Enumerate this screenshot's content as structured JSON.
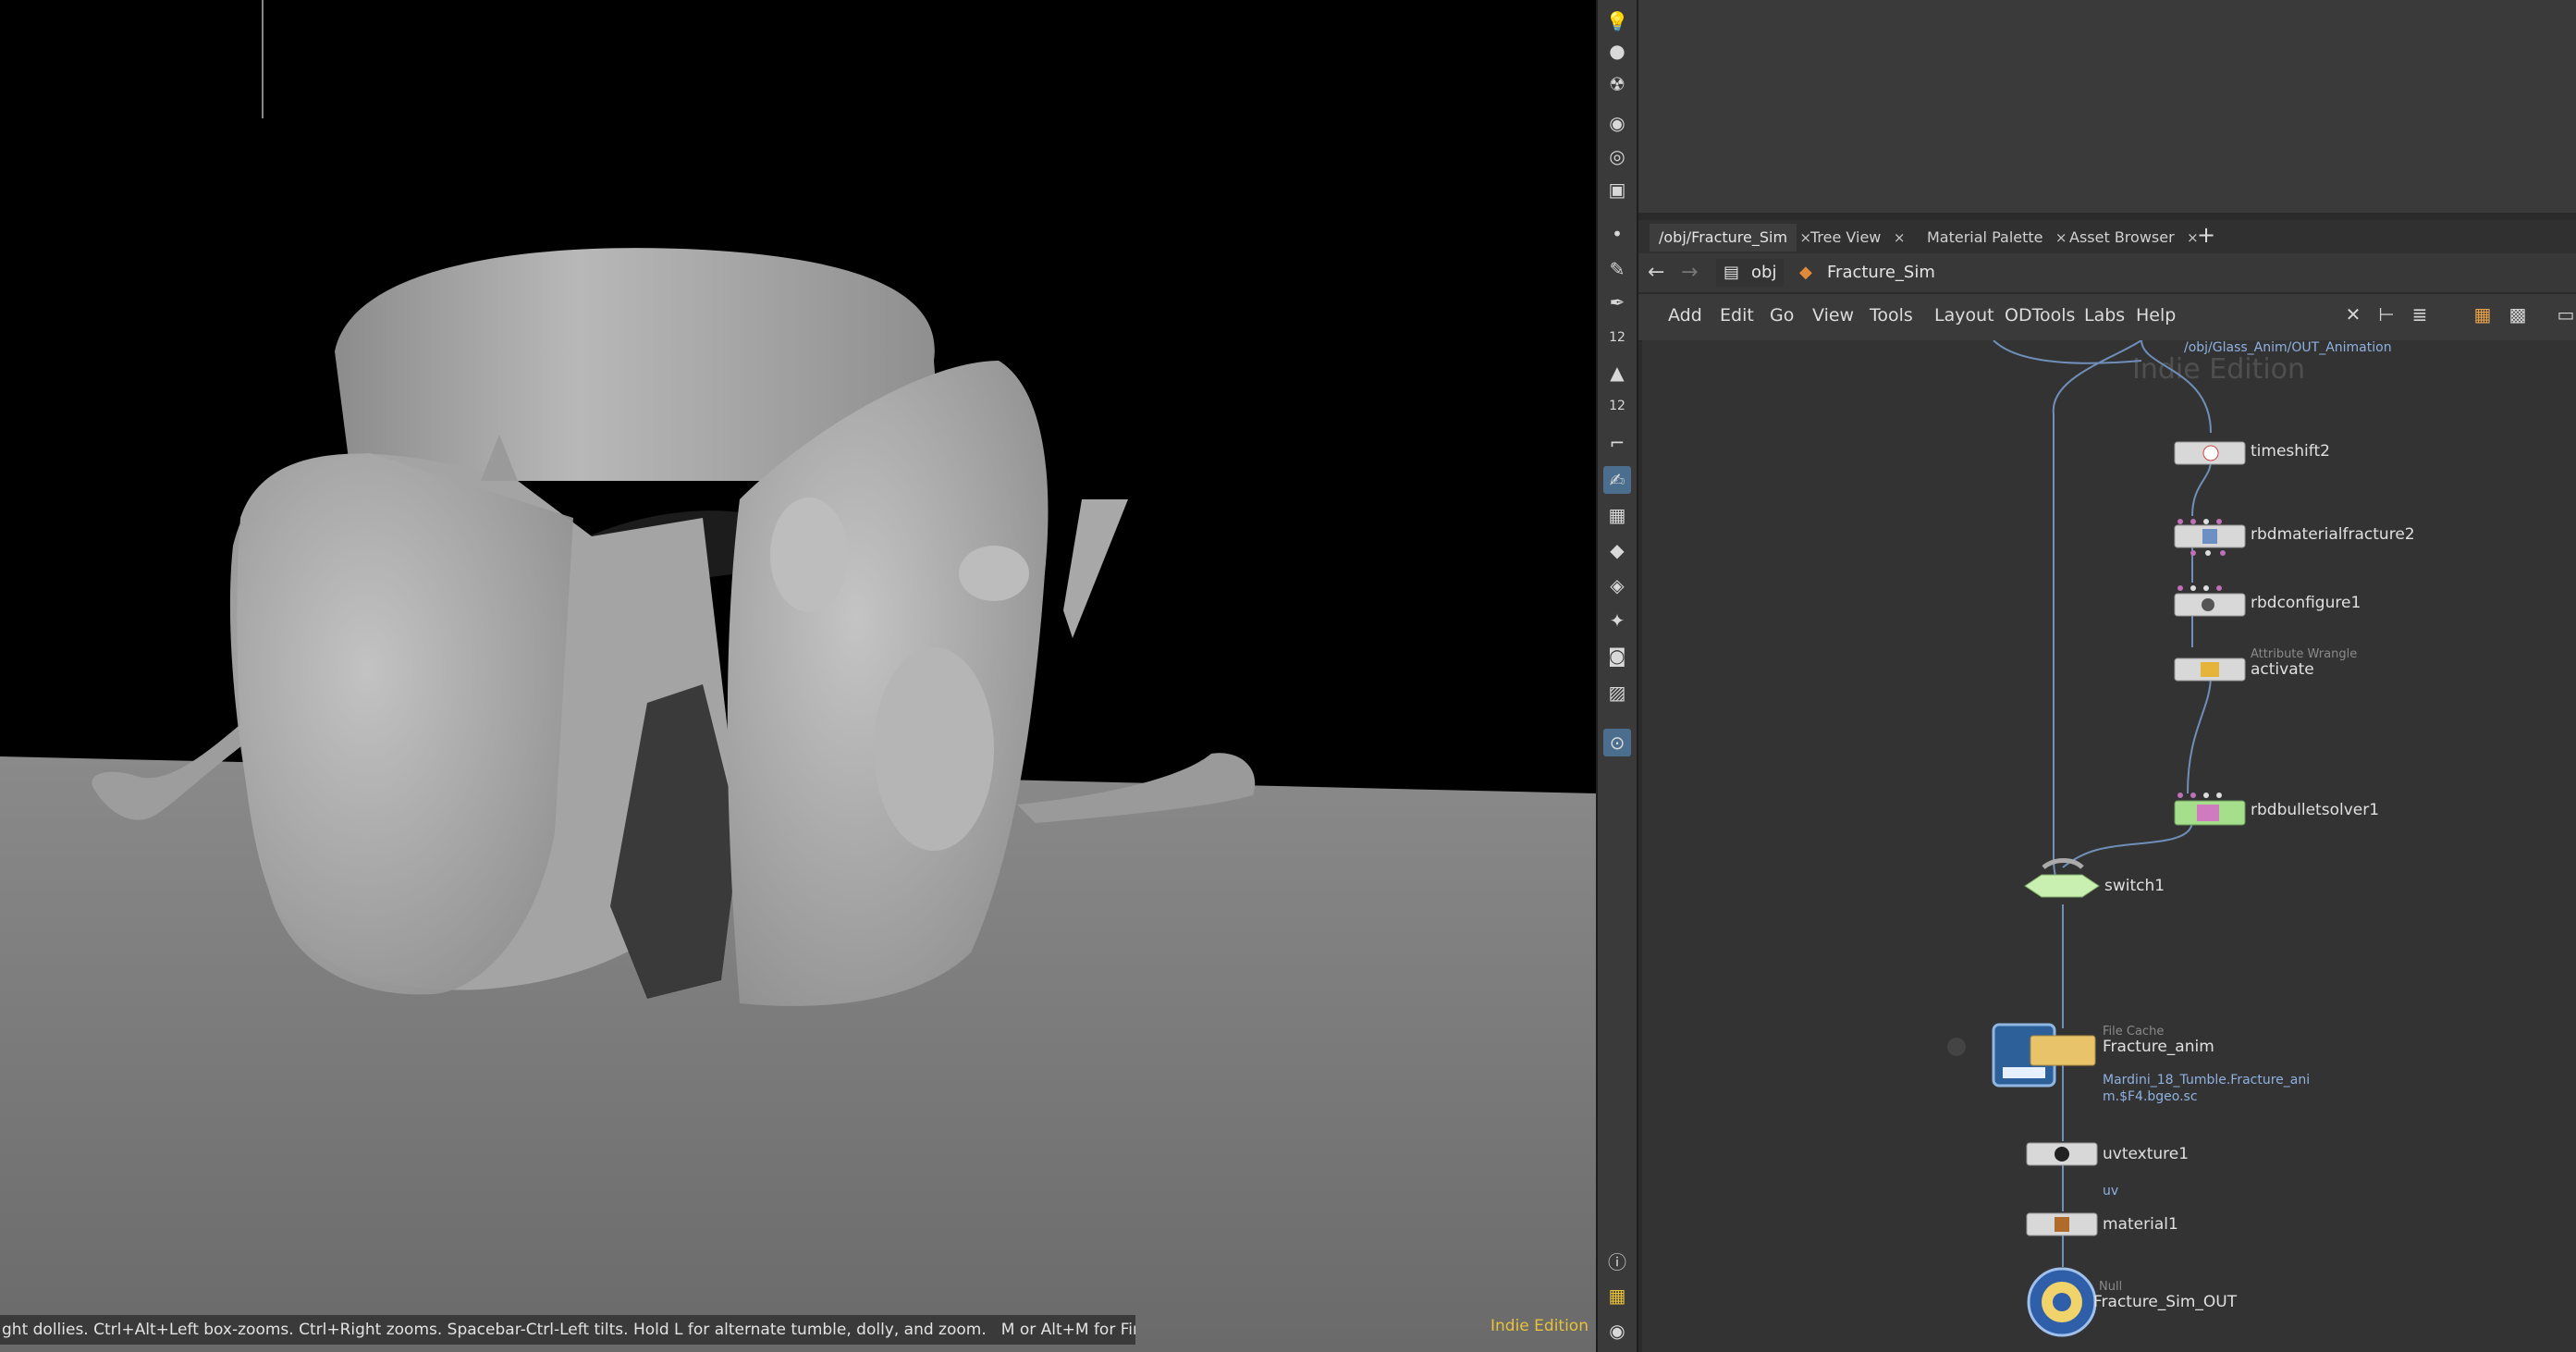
{
  "viewport": {
    "status_hint": "ght dollies. Ctrl+Alt+Left box-zooms. Ctrl+Right zooms. Spacebar-Ctrl-Left tilts. Hold L for alternate tumble, dolly, and zoom.",
    "status_hint2": "M or Alt+M for First Person Navigation.",
    "edition_label": "Indie Edition"
  },
  "shelf": {
    "icons": [
      "light-icon",
      "point-light-icon",
      "spot-light-icon",
      "camera-icon",
      "view-camera-icon",
      "flipbook-camera-icon",
      "dot-icon",
      "brush-icon",
      "pen-icon",
      "number-12-icon",
      "paint-icon",
      "number-12b-icon",
      "curve-icon",
      "select-pose-icon",
      "checker-icon",
      "transform-icon",
      "gem-icon",
      "measure-icon",
      "render-icon",
      "snapshot-icon",
      "pin-icon",
      "info-icon",
      "grid-icon",
      "eye-icon"
    ]
  },
  "tabs": [
    {
      "label": "/obj/Fracture_Sim",
      "close": "×"
    },
    {
      "label": "Tree View",
      "close": "×"
    },
    {
      "label": "Material Palette",
      "close": "×"
    },
    {
      "label": "Asset Browser",
      "close": "×"
    }
  ],
  "tab_add": "+",
  "path": {
    "back": "←",
    "forward": "→",
    "crumb1": "obj",
    "crumb2": "Fracture_Sim"
  },
  "menu": [
    "Add",
    "Edit",
    "Go",
    "View",
    "Tools",
    "Layout",
    "ODTools",
    "Labs",
    "Help"
  ],
  "network": {
    "watermark": "Indie Edition",
    "import_path": "/obj/Glass_Anim/OUT_Animation",
    "nodes": {
      "timeshift": "timeshift2",
      "materialfracture": "rbdmaterialfracture2",
      "configure": "rbdconfigure1",
      "wrangle_type": "Attribute Wrangle",
      "wrangle": "activate",
      "solver": "rbdbulletsolver1",
      "switch": "switch1",
      "filecache_type": "File Cache",
      "filecache": "Fracture_anim",
      "filecache_path1": "Mardini_18_Tumble.Fracture_ani",
      "filecache_path2": "m.$F4.bgeo.sc",
      "uvtexture": "uvtexture1",
      "uv_attr": "uv",
      "material": "material1",
      "null_type": "Null",
      "null": "Fracture_Sim_OUT"
    }
  },
  "colors": {
    "viewport_bg": "#000000",
    "ground": "#7a7a7a",
    "network_bg": "#333333",
    "wire": "#6f8fb8",
    "switch_node": "#c9f0b0",
    "solver_node": "#a6df8c",
    "filecache_node": "#e8c36a",
    "null_node": "#2e5fa8",
    "indie_yellow": "#e8c23a"
  }
}
